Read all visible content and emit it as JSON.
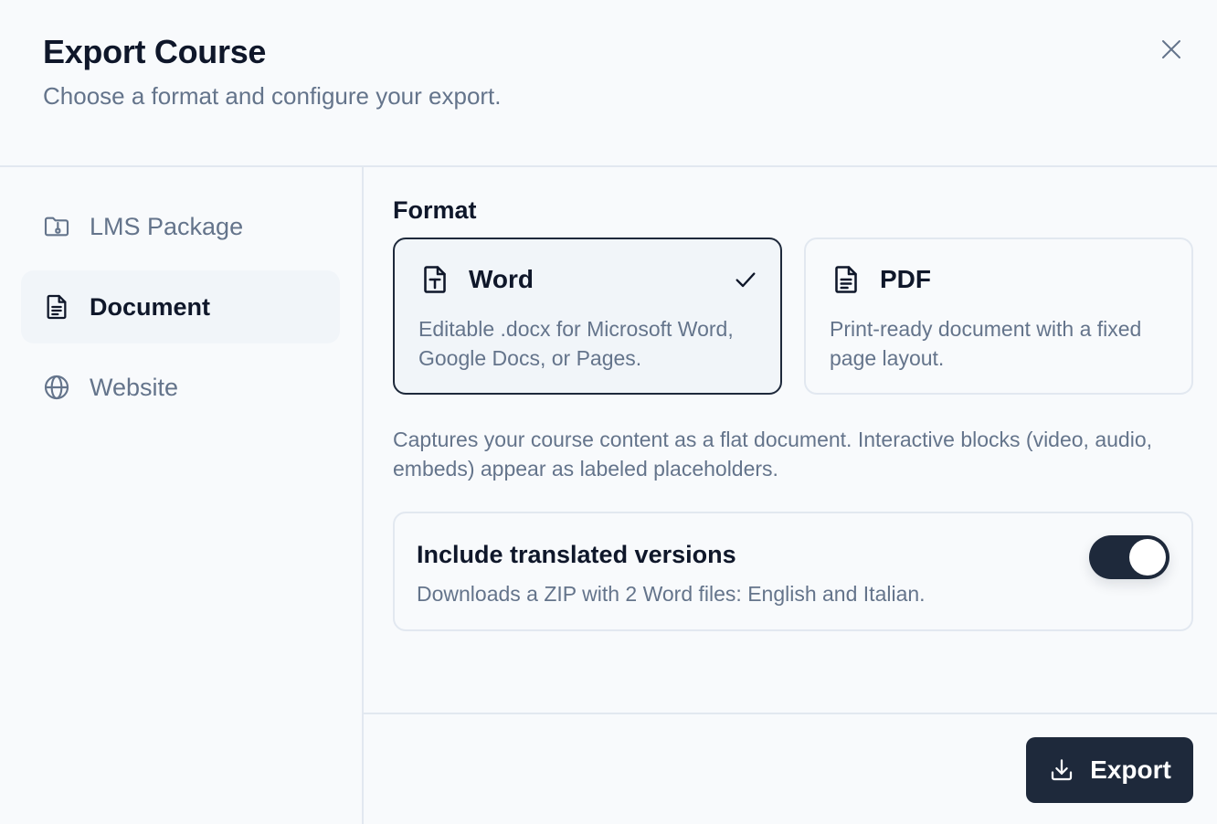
{
  "dialog": {
    "title": "Export Course",
    "subtitle": "Choose a format and configure your export.",
    "close_icon": "close-icon"
  },
  "sidebar": {
    "items": [
      {
        "label": "LMS Package",
        "icon": "folder-package-icon",
        "active": false
      },
      {
        "label": "Document",
        "icon": "document-icon",
        "active": true
      },
      {
        "label": "Website",
        "icon": "globe-icon",
        "active": false
      }
    ]
  },
  "main": {
    "section_label": "Format",
    "formats": [
      {
        "title": "Word",
        "description": "Editable .docx for Microsoft Word, Google Docs, or Pages.",
        "icon": "word-file-icon",
        "selected": true
      },
      {
        "title": "PDF",
        "description": "Print-ready document with a fixed page layout.",
        "icon": "pdf-file-icon",
        "selected": false
      }
    ],
    "info_text": "Captures your course content as a flat document. Interactive blocks (video, audio, embeds) appear as labeled placeholders.",
    "translated_option": {
      "title": "Include translated versions",
      "description": "Downloads a ZIP with 2 Word files: English and Italian.",
      "enabled": true
    }
  },
  "footer": {
    "export_label": "Export",
    "export_icon": "download-icon"
  },
  "colors": {
    "background": "#f8fafc",
    "primary": "#1e293b",
    "muted_text": "#64748b",
    "border": "#e2e8f0"
  }
}
